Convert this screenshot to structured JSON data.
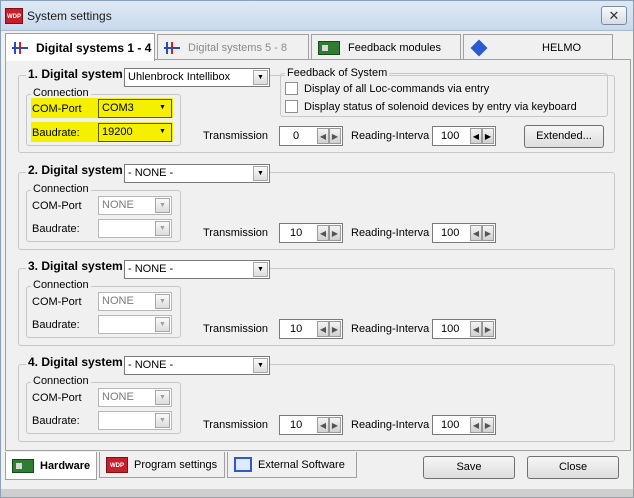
{
  "window": {
    "title": "System settings",
    "close": "✕",
    "app_icon_text": "WDP"
  },
  "tabs": [
    {
      "label": "Digital systems 1 - 4",
      "icon": "rail-icon",
      "active": true
    },
    {
      "label": "Digital systems 5 - 8",
      "icon": "rail-icon",
      "active": false
    },
    {
      "label": "Feedback modules",
      "icon": "board-icon",
      "active": false
    },
    {
      "label": "HELMO",
      "icon": "helmo-icon",
      "active": false
    }
  ],
  "systems": [
    {
      "title": "1. Digital system",
      "device": "Uhlenbrock Intellibox",
      "connection_label": "Connection",
      "com_label": "COM-Port",
      "com_value": "COM3",
      "baud_label": "Baudrate:",
      "baud_value": "19200",
      "transmission_label": "Transmission",
      "transmission_value": "0",
      "reading_label": "Reading-Interva",
      "reading_value": "100",
      "enabled": true
    },
    {
      "title": "2. Digital system",
      "device": "- NONE -",
      "connection_label": "Connection",
      "com_label": "COM-Port",
      "com_value": "NONE",
      "baud_label": "Baudrate:",
      "baud_value": "",
      "transmission_label": "Transmission",
      "transmission_value": "10",
      "reading_label": "Reading-Interva",
      "reading_value": "100",
      "enabled": false
    },
    {
      "title": "3. Digital system",
      "device": "- NONE -",
      "connection_label": "Connection",
      "com_label": "COM-Port",
      "com_value": "NONE",
      "baud_label": "Baudrate:",
      "baud_value": "",
      "transmission_label": "Transmission",
      "transmission_value": "10",
      "reading_label": "Reading-Interva",
      "reading_value": "100",
      "enabled": false
    },
    {
      "title": "4. Digital system",
      "device": "- NONE -",
      "connection_label": "Connection",
      "com_label": "COM-Port",
      "com_value": "NONE",
      "baud_label": "Baudrate:",
      "baud_value": "",
      "transmission_label": "Transmission",
      "transmission_value": "10",
      "reading_label": "Reading-Interva",
      "reading_value": "100",
      "enabled": false
    }
  ],
  "feedback": {
    "title": "Feedback of System",
    "option1": "Display of all Loc-commands via entry",
    "option2": "Display status of solenoid devices by entry via keyboard"
  },
  "extended_button": "Extended...",
  "bottom_tabs": [
    {
      "label": "Hardware",
      "active": true
    },
    {
      "label": "Program settings",
      "active": false
    },
    {
      "label": "External Software",
      "active": false
    }
  ],
  "buttons": {
    "save": "Save",
    "close": "Close"
  },
  "colors": {
    "highlight": "#f4f000",
    "title_bar": "#c9d9ec"
  }
}
